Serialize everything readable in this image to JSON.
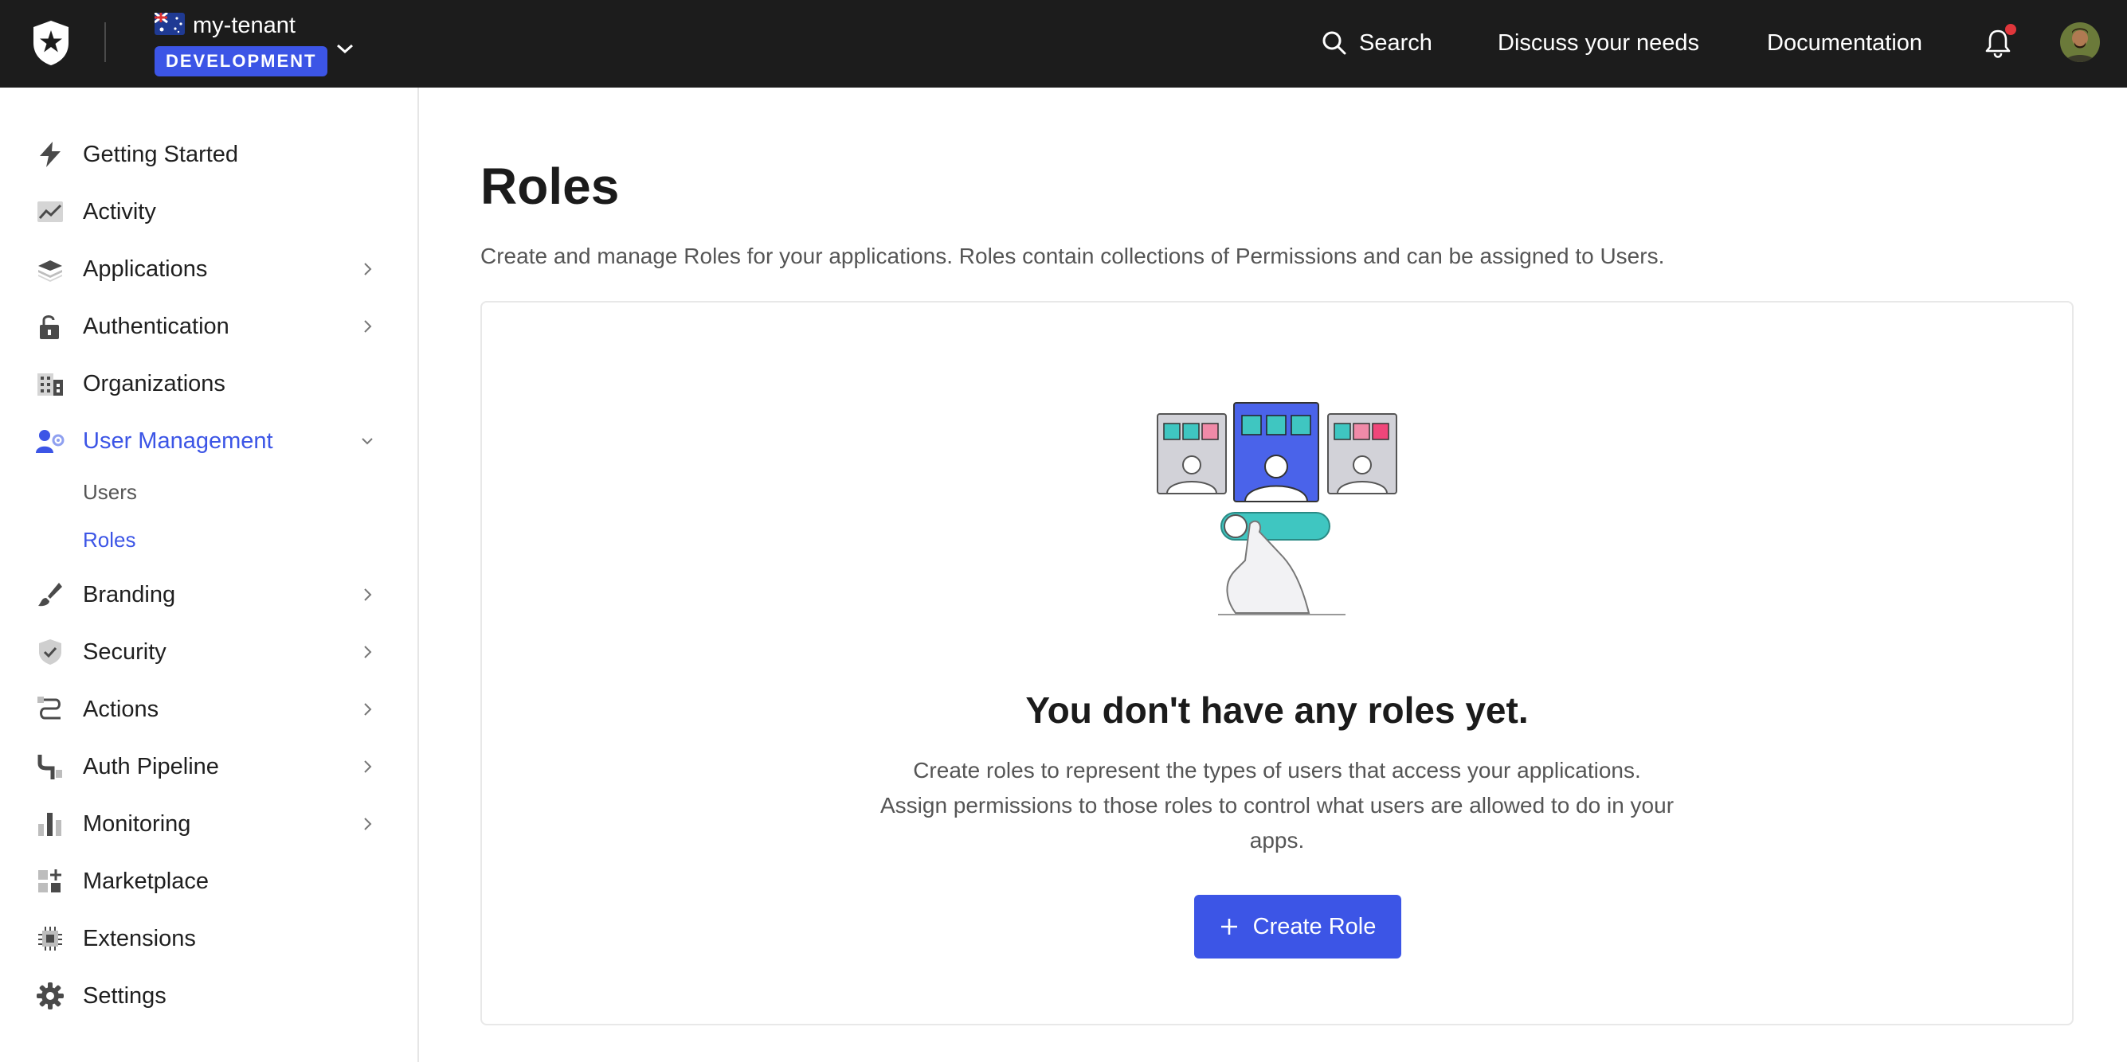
{
  "topbar": {
    "tenant_name": "my-tenant",
    "environment_badge": "DEVELOPMENT",
    "search_label": "Search",
    "discuss_label": "Discuss your needs",
    "docs_label": "Documentation",
    "notification_dot_color": "#e0363b"
  },
  "sidebar": {
    "items": [
      {
        "label": "Getting Started",
        "icon": "lightning-icon"
      },
      {
        "label": "Activity",
        "icon": "activity-chart-icon"
      },
      {
        "label": "Applications",
        "icon": "layers-icon"
      },
      {
        "label": "Authentication",
        "icon": "unlock-icon"
      },
      {
        "label": "Organizations",
        "icon": "building-icon"
      },
      {
        "label": "User Management",
        "icon": "user-gear-icon"
      },
      {
        "label": "Branding",
        "icon": "paintbrush-icon"
      },
      {
        "label": "Security",
        "icon": "shield-check-icon"
      },
      {
        "label": "Actions",
        "icon": "flow-icon"
      },
      {
        "label": "Auth Pipeline",
        "icon": "pipe-icon"
      },
      {
        "label": "Monitoring",
        "icon": "bar-chart-icon"
      },
      {
        "label": "Marketplace",
        "icon": "grid-plus-icon"
      },
      {
        "label": "Extensions",
        "icon": "chip-icon"
      },
      {
        "label": "Settings",
        "icon": "gear-icon"
      }
    ],
    "user_management_sub": [
      {
        "label": "Users"
      },
      {
        "label": "Roles"
      }
    ],
    "active_item": "User Management",
    "active_sub_item": "Roles"
  },
  "main": {
    "title": "Roles",
    "description": "Create and manage Roles for your applications. Roles contain collections of Permissions and can be assigned to Users.",
    "empty_state": {
      "title": "You don't have any roles yet.",
      "description": "Create roles to represent the types of users that access your applications. Assign permissions to those roles to control what users are allowed to do in your apps.",
      "button_label": "Create Role"
    }
  },
  "colors": {
    "accent": "#3c55e6",
    "topbar_bg": "#1c1c1c"
  }
}
